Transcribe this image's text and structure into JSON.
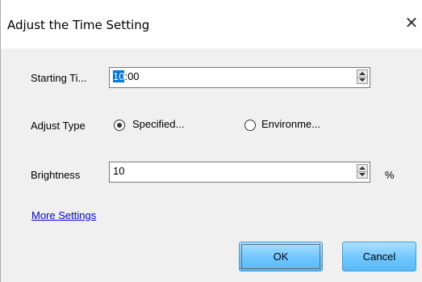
{
  "dialog": {
    "title": "Adjust the Time Setting",
    "close_glyph": "✕"
  },
  "starting_time": {
    "label": "Starting Ti...",
    "value_selected": "10",
    "value_rest": ":00"
  },
  "adjust_type": {
    "label": "Adjust Type",
    "options": [
      {
        "label": "Specified...",
        "selected": true
      },
      {
        "label": "Environme...",
        "selected": false
      }
    ]
  },
  "brightness": {
    "label": "Brightness",
    "value": "10",
    "unit": "%"
  },
  "more_settings_label": "More Settings",
  "buttons": {
    "ok": "OK",
    "cancel": "Cancel"
  },
  "colors": {
    "selection": "#0078d7",
    "link": "#0000ee",
    "button_fill": "#6ec6ff"
  }
}
